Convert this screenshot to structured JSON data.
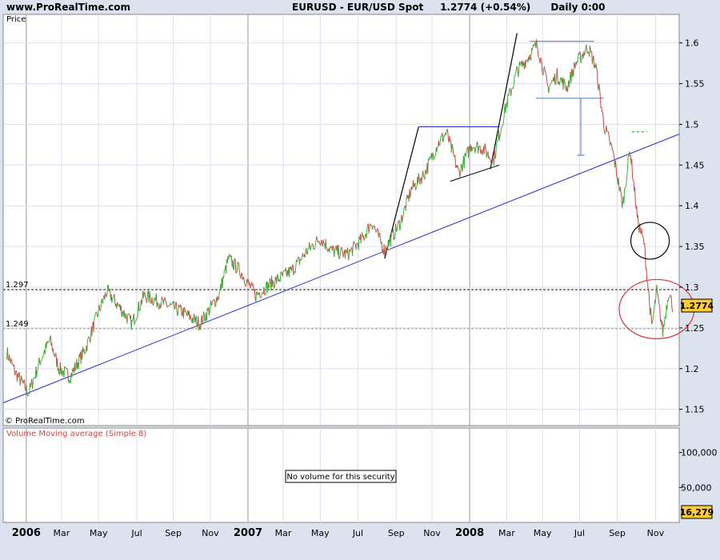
{
  "header": {
    "site": "www.ProRealTime.com",
    "symbol": "EURUSD",
    "instrument": "EUR/USD Spot",
    "last": "1.2774",
    "change": "(+0.54%)",
    "period": "Daily",
    "time": "0:00"
  },
  "price_panel": {
    "ylabel": "Price",
    "watermark": "© ProRealTime.com",
    "last_tag": "1.2774",
    "level_labels": [
      "1.297",
      "1.249"
    ]
  },
  "volume_panel": {
    "title": "Volume Moving average (Simple 8)",
    "message": "No volume for this security",
    "last_tag": "16,279",
    "yticks": [
      "100,000",
      "50,000"
    ]
  },
  "colors": {
    "up": "#38b838",
    "down": "#cc4444",
    "trend": "#2b2bd6",
    "sr": "#3333cc",
    "accent": "#ffcc33",
    "bg": "#dce3ee"
  },
  "chart_data": [
    {
      "type": "line",
      "title": "EURUSD - EUR/USD Spot",
      "xlabel": "",
      "ylabel": "Price",
      "ylim": [
        1.13,
        1.635
      ],
      "yticks": [
        1.15,
        1.2,
        1.25,
        1.3,
        1.35,
        1.4,
        1.45,
        1.5,
        1.55,
        1.6
      ],
      "xticks": [
        {
          "label": "2006",
          "date": "2006-01-02",
          "bold": true
        },
        {
          "label": "Mar",
          "date": "2006-03-01"
        },
        {
          "label": "May",
          "date": "2006-05-01"
        },
        {
          "label": "Jul",
          "date": "2006-07-03"
        },
        {
          "label": "Sep",
          "date": "2006-09-01"
        },
        {
          "label": "Nov",
          "date": "2006-11-01"
        },
        {
          "label": "2007",
          "date": "2007-01-02",
          "bold": true
        },
        {
          "label": "Mar",
          "date": "2007-03-01"
        },
        {
          "label": "May",
          "date": "2007-05-01"
        },
        {
          "label": "Jul",
          "date": "2007-07-02"
        },
        {
          "label": "Sep",
          "date": "2007-09-03"
        },
        {
          "label": "Nov",
          "date": "2007-11-01"
        },
        {
          "label": "2008",
          "date": "2008-01-02",
          "bold": true
        },
        {
          "label": "Mar",
          "date": "2008-03-03"
        },
        {
          "label": "May",
          "date": "2008-05-01"
        },
        {
          "label": "Jul",
          "date": "2008-07-01"
        },
        {
          "label": "Sep",
          "date": "2008-09-01"
        },
        {
          "label": "Nov",
          "date": "2008-11-03"
        }
      ],
      "series": [
        {
          "values": [
            {
              "x": "2005-12-01",
              "y": 1.22
            },
            {
              "x": "2005-12-15",
              "y": 1.195
            },
            {
              "x": "2006-01-06",
              "y": 1.17
            },
            {
              "x": "2006-01-25",
              "y": 1.21
            },
            {
              "x": "2006-02-10",
              "y": 1.235
            },
            {
              "x": "2006-02-25",
              "y": 1.2
            },
            {
              "x": "2006-03-15",
              "y": 1.19
            },
            {
              "x": "2006-04-10",
              "y": 1.225
            },
            {
              "x": "2006-05-01",
              "y": 1.27
            },
            {
              "x": "2006-05-15",
              "y": 1.295
            },
            {
              "x": "2006-06-10",
              "y": 1.27
            },
            {
              "x": "2006-06-25",
              "y": 1.255
            },
            {
              "x": "2006-07-15",
              "y": 1.29
            },
            {
              "x": "2006-08-15",
              "y": 1.28
            },
            {
              "x": "2006-09-15",
              "y": 1.27
            },
            {
              "x": "2006-10-15",
              "y": 1.255
            },
            {
              "x": "2006-11-15",
              "y": 1.29
            },
            {
              "x": "2006-12-01",
              "y": 1.335
            },
            {
              "x": "2006-12-20",
              "y": 1.32
            },
            {
              "x": "2007-01-15",
              "y": 1.29
            },
            {
              "x": "2007-02-10",
              "y": 1.305
            },
            {
              "x": "2007-03-15",
              "y": 1.32
            },
            {
              "x": "2007-04-10",
              "y": 1.345
            },
            {
              "x": "2007-05-01",
              "y": 1.36
            },
            {
              "x": "2007-05-20",
              "y": 1.345
            },
            {
              "x": "2007-06-15",
              "y": 1.34
            },
            {
              "x": "2007-07-10",
              "y": 1.36
            },
            {
              "x": "2007-07-25",
              "y": 1.38
            },
            {
              "x": "2007-08-15",
              "y": 1.345
            },
            {
              "x": "2007-09-10",
              "y": 1.38
            },
            {
              "x": "2007-09-28",
              "y": 1.42
            },
            {
              "x": "2007-10-20",
              "y": 1.44
            },
            {
              "x": "2007-11-10",
              "y": 1.475
            },
            {
              "x": "2007-11-25",
              "y": 1.49
            },
            {
              "x": "2007-12-15",
              "y": 1.44
            },
            {
              "x": "2008-01-05",
              "y": 1.475
            },
            {
              "x": "2008-01-25",
              "y": 1.47
            },
            {
              "x": "2008-02-10",
              "y": 1.455
            },
            {
              "x": "2008-03-01",
              "y": 1.52
            },
            {
              "x": "2008-03-20",
              "y": 1.565
            },
            {
              "x": "2008-04-05",
              "y": 1.58
            },
            {
              "x": "2008-04-22",
              "y": 1.598
            },
            {
              "x": "2008-05-10",
              "y": 1.545
            },
            {
              "x": "2008-05-25",
              "y": 1.56
            },
            {
              "x": "2008-06-10",
              "y": 1.545
            },
            {
              "x": "2008-06-25",
              "y": 1.575
            },
            {
              "x": "2008-07-15",
              "y": 1.595
            },
            {
              "x": "2008-07-28",
              "y": 1.57
            },
            {
              "x": "2008-08-10",
              "y": 1.5
            },
            {
              "x": "2008-08-25",
              "y": 1.465
            },
            {
              "x": "2008-09-10",
              "y": 1.4
            },
            {
              "x": "2008-09-22",
              "y": 1.47
            },
            {
              "x": "2008-10-05",
              "y": 1.38
            },
            {
              "x": "2008-10-15",
              "y": 1.355
            },
            {
              "x": "2008-10-28",
              "y": 1.25
            },
            {
              "x": "2008-11-05",
              "y": 1.295
            },
            {
              "x": "2008-11-15",
              "y": 1.245
            },
            {
              "x": "2008-11-25",
              "y": 1.295
            },
            {
              "x": "2008-12-01",
              "y": 1.2774
            }
          ]
        }
      ],
      "levels": [
        1.297,
        1.249
      ]
    },
    {
      "type": "bar",
      "title": "Volume Moving average (Simple 8)",
      "ylabel": "",
      "yticks": [
        100000,
        50000
      ],
      "ylim": [
        0,
        135000
      ],
      "values": []
    }
  ]
}
